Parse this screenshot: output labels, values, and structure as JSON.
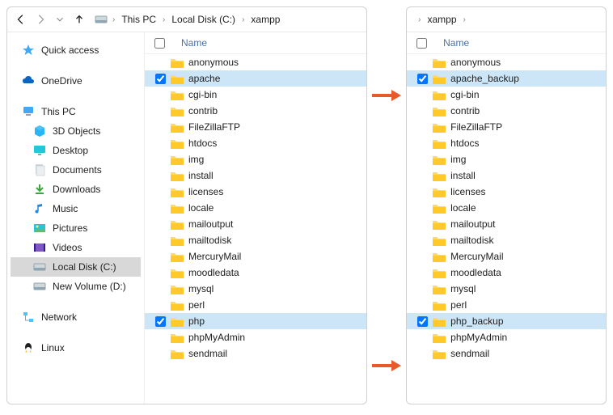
{
  "left": {
    "breadcrumb": [
      "This PC",
      "Local Disk (C:)",
      "xampp"
    ],
    "sidebar": {
      "quick": "Quick access",
      "onedrive": "OneDrive",
      "thispc": "This PC",
      "objects3d": "3D Objects",
      "desktop": "Desktop",
      "documents": "Documents",
      "downloads": "Downloads",
      "music": "Music",
      "pictures": "Pictures",
      "videos": "Videos",
      "localc": "Local Disk (C:)",
      "newvol": "New Volume (D:)",
      "network": "Network",
      "linux": "Linux"
    },
    "col_header": "Name",
    "items": [
      {
        "name": "anonymous",
        "checked": false,
        "selected": false
      },
      {
        "name": "apache",
        "checked": true,
        "selected": true
      },
      {
        "name": "cgi-bin",
        "checked": false,
        "selected": false
      },
      {
        "name": "contrib",
        "checked": false,
        "selected": false
      },
      {
        "name": "FileZillaFTP",
        "checked": false,
        "selected": false
      },
      {
        "name": "htdocs",
        "checked": false,
        "selected": false
      },
      {
        "name": "img",
        "checked": false,
        "selected": false
      },
      {
        "name": "install",
        "checked": false,
        "selected": false
      },
      {
        "name": "licenses",
        "checked": false,
        "selected": false
      },
      {
        "name": "locale",
        "checked": false,
        "selected": false
      },
      {
        "name": "mailoutput",
        "checked": false,
        "selected": false
      },
      {
        "name": "mailtodisk",
        "checked": false,
        "selected": false
      },
      {
        "name": "MercuryMail",
        "checked": false,
        "selected": false
      },
      {
        "name": "moodledata",
        "checked": false,
        "selected": false
      },
      {
        "name": "mysql",
        "checked": false,
        "selected": false
      },
      {
        "name": "perl",
        "checked": false,
        "selected": false
      },
      {
        "name": "php",
        "checked": true,
        "selected": true
      },
      {
        "name": "phpMyAdmin",
        "checked": false,
        "selected": false
      },
      {
        "name": "sendmail",
        "checked": false,
        "selected": false
      }
    ]
  },
  "right": {
    "breadcrumb": [
      "xampp"
    ],
    "col_header": "Name",
    "items": [
      {
        "name": "anonymous",
        "checked": false,
        "selected": false
      },
      {
        "name": "apache_backup",
        "checked": true,
        "selected": true
      },
      {
        "name": "cgi-bin",
        "checked": false,
        "selected": false
      },
      {
        "name": "contrib",
        "checked": false,
        "selected": false
      },
      {
        "name": "FileZillaFTP",
        "checked": false,
        "selected": false
      },
      {
        "name": "htdocs",
        "checked": false,
        "selected": false
      },
      {
        "name": "img",
        "checked": false,
        "selected": false
      },
      {
        "name": "install",
        "checked": false,
        "selected": false
      },
      {
        "name": "licenses",
        "checked": false,
        "selected": false
      },
      {
        "name": "locale",
        "checked": false,
        "selected": false
      },
      {
        "name": "mailoutput",
        "checked": false,
        "selected": false
      },
      {
        "name": "mailtodisk",
        "checked": false,
        "selected": false
      },
      {
        "name": "MercuryMail",
        "checked": false,
        "selected": false
      },
      {
        "name": "moodledata",
        "checked": false,
        "selected": false
      },
      {
        "name": "mysql",
        "checked": false,
        "selected": false
      },
      {
        "name": "perl",
        "checked": false,
        "selected": false
      },
      {
        "name": "php_backup",
        "checked": true,
        "selected": true
      },
      {
        "name": "phpMyAdmin",
        "checked": false,
        "selected": false
      },
      {
        "name": "sendmail",
        "checked": false,
        "selected": false
      }
    ]
  }
}
